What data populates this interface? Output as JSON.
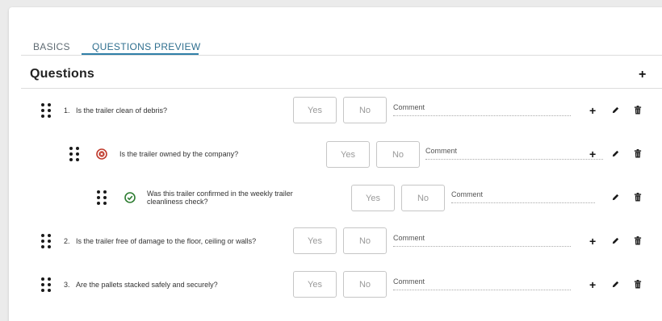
{
  "tabs": [
    {
      "label": "BASICS"
    },
    {
      "label": "QUESTIONS PREVIEW"
    }
  ],
  "section": {
    "title": "Questions"
  },
  "questions": [
    {
      "number": "1.",
      "text": "Is the trailer clean of debris?",
      "yes": "Yes",
      "no": "No",
      "comment_placeholder": "Comment"
    },
    {
      "number": "",
      "text": "Is the trailer owned by the company?",
      "yes": "Yes",
      "no": "No",
      "comment_placeholder": "Comment",
      "status": "rejected"
    },
    {
      "number": "",
      "text": "Was this trailer confirmed in the weekly trailer cleanliness check?",
      "yes": "Yes",
      "no": "No",
      "comment_placeholder": "Comment",
      "status": "accepted"
    },
    {
      "number": "2.",
      "text": "Is the trailer free of damage to the floor, ceiling or walls?",
      "yes": "Yes",
      "no": "No",
      "comment_placeholder": "Comment"
    },
    {
      "number": "3.",
      "text": "Are the pallets stacked safely and securely?",
      "yes": "Yes",
      "no": "No",
      "comment_placeholder": "Comment"
    }
  ],
  "colors": {
    "accent": "#2f7fa8",
    "rejected": "#c0392b",
    "accepted": "#2e7d32"
  }
}
